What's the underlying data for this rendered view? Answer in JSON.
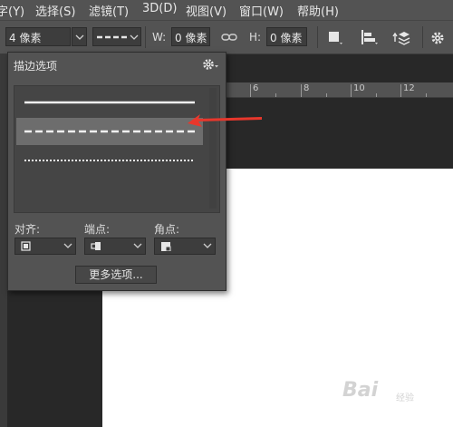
{
  "menu": {
    "items": [
      "字(Y)",
      "选择(S)",
      "滤镜(T)",
      "3D(D)",
      "视图(V)",
      "窗口(W)",
      "帮助(H)"
    ]
  },
  "options_bar": {
    "stroke_width_value": "4 像素",
    "w_label": "W:",
    "w_value": "0 像素",
    "h_label": "H:",
    "h_value": "0 像素"
  },
  "ruler": {
    "ticks": [
      "6",
      "8",
      "10",
      "12"
    ]
  },
  "panel": {
    "title": "描边选项",
    "stroke_styles": [
      "solid",
      "dashed",
      "dotted"
    ],
    "selected_style": "dashed",
    "align_label": "对齐:",
    "caps_label": "端点:",
    "corners_label": "角点:",
    "more_button": "更多选项..."
  },
  "colors": {
    "panel_bg": "#535353",
    "workspace_bg": "#282828",
    "arrow": "#e8372c",
    "selected_row": "#6d6d6d"
  },
  "watermark": {
    "brand": "Bai",
    "sub": "经验"
  }
}
